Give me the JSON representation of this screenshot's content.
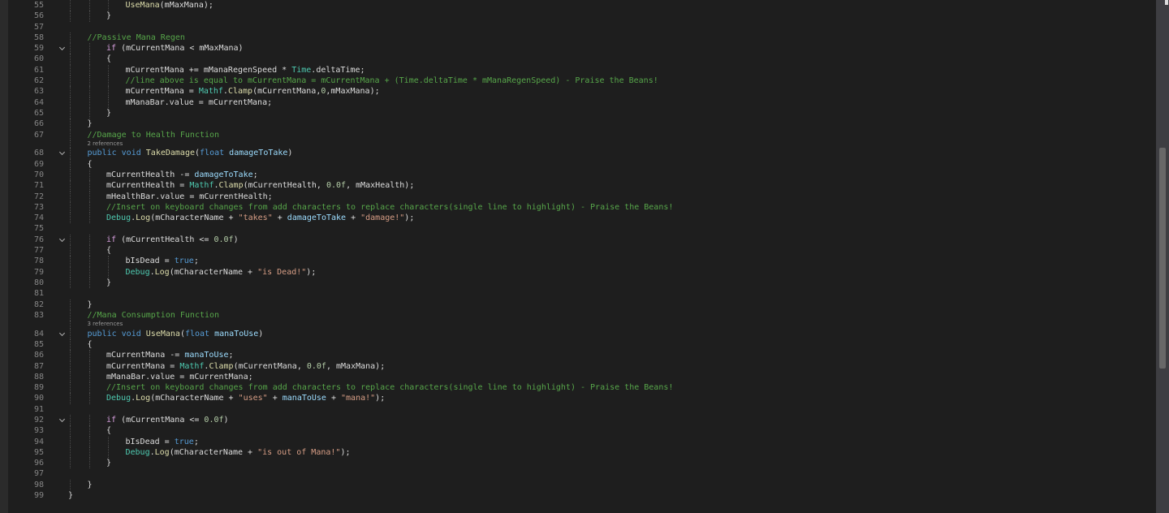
{
  "editor": {
    "file_language": "C#",
    "scrollbar": {
      "vertical": true
    },
    "colors": {
      "background": "#1e1e1e",
      "line_number": "#858585",
      "keyword": "#569cd6",
      "control_keyword": "#d8a0df",
      "type": "#4ec9b0",
      "method": "#dcdcaa",
      "parameter": "#9cdcfe",
      "number": "#b5cea8",
      "string": "#d69d85",
      "comment": "#57a64a",
      "text": "#dcdcdc"
    },
    "rows": [
      {
        "kind": "code",
        "ln": "55",
        "indent": 3,
        "fold": false,
        "tokens": [
          [
            "method",
            "UseMana"
          ],
          [
            "txt",
            "(mMaxMana);"
          ]
        ]
      },
      {
        "kind": "code",
        "ln": "56",
        "indent": 2,
        "fold": false,
        "tokens": [
          [
            "txt",
            "}"
          ]
        ]
      },
      {
        "kind": "code",
        "ln": "57",
        "indent": 0,
        "fold": false,
        "tokens": []
      },
      {
        "kind": "code",
        "ln": "58",
        "indent": 1,
        "fold": false,
        "tokens": [
          [
            "com",
            "//Passive Mana Regen"
          ]
        ]
      },
      {
        "kind": "code",
        "ln": "59",
        "indent": 2,
        "fold": true,
        "tokens": [
          [
            "ctl",
            "if"
          ],
          [
            "txt",
            " (mCurrentMana < mMaxMana)"
          ]
        ]
      },
      {
        "kind": "code",
        "ln": "60",
        "indent": 2,
        "fold": false,
        "tokens": [
          [
            "txt",
            "{"
          ]
        ]
      },
      {
        "kind": "code",
        "ln": "61",
        "indent": 3,
        "fold": false,
        "tokens": [
          [
            "txt",
            "mCurrentMana += mManaRegenSpeed * "
          ],
          [
            "type",
            "Time"
          ],
          [
            "txt",
            ".deltaTime;"
          ]
        ]
      },
      {
        "kind": "code",
        "ln": "62",
        "indent": 3,
        "fold": false,
        "tokens": [
          [
            "com",
            "//line above is equal to mCurrentMana = mCurrentMana + (Time.deltaTime * mManaRegenSpeed) - Praise the Beans!"
          ]
        ]
      },
      {
        "kind": "code",
        "ln": "63",
        "indent": 3,
        "fold": false,
        "tokens": [
          [
            "txt",
            "mCurrentMana = "
          ],
          [
            "type",
            "Mathf"
          ],
          [
            "txt",
            "."
          ],
          [
            "method",
            "Clamp"
          ],
          [
            "txt",
            "(mCurrentMana,"
          ],
          [
            "num",
            "0"
          ],
          [
            "txt",
            ",mMaxMana);"
          ]
        ]
      },
      {
        "kind": "code",
        "ln": "64",
        "indent": 3,
        "fold": false,
        "tokens": [
          [
            "txt",
            "mManaBar.value = mCurrentMana;"
          ]
        ]
      },
      {
        "kind": "code",
        "ln": "65",
        "indent": 2,
        "fold": false,
        "tokens": [
          [
            "txt",
            "}"
          ]
        ]
      },
      {
        "kind": "code",
        "ln": "66",
        "indent": 1,
        "fold": false,
        "tokens": [
          [
            "txt",
            "}"
          ]
        ]
      },
      {
        "kind": "code",
        "ln": "67",
        "indent": 1,
        "fold": false,
        "tokens": [
          [
            "com",
            "//Damage to Health Function"
          ]
        ]
      },
      {
        "kind": "lens",
        "text": "2 references"
      },
      {
        "kind": "code",
        "ln": "68",
        "indent": 1,
        "fold": true,
        "tokens": [
          [
            "kw",
            "public"
          ],
          [
            "txt",
            " "
          ],
          [
            "kw",
            "void"
          ],
          [
            "txt",
            " "
          ],
          [
            "method",
            "TakeDamage"
          ],
          [
            "txt",
            "("
          ],
          [
            "kw",
            "float"
          ],
          [
            "txt",
            " "
          ],
          [
            "param",
            "damageToTake"
          ],
          [
            "txt",
            ")"
          ]
        ]
      },
      {
        "kind": "code",
        "ln": "69",
        "indent": 1,
        "fold": false,
        "tokens": [
          [
            "txt",
            "{"
          ]
        ]
      },
      {
        "kind": "code",
        "ln": "70",
        "indent": 2,
        "fold": false,
        "tokens": [
          [
            "txt",
            "mCurrentHealth -= "
          ],
          [
            "param",
            "damageToTake"
          ],
          [
            "txt",
            ";"
          ]
        ]
      },
      {
        "kind": "code",
        "ln": "71",
        "indent": 2,
        "fold": false,
        "tokens": [
          [
            "txt",
            "mCurrentHealth = "
          ],
          [
            "type",
            "Mathf"
          ],
          [
            "txt",
            "."
          ],
          [
            "method",
            "Clamp"
          ],
          [
            "txt",
            "(mCurrentHealth, "
          ],
          [
            "num",
            "0.0f"
          ],
          [
            "txt",
            ", mMaxHealth);"
          ]
        ]
      },
      {
        "kind": "code",
        "ln": "72",
        "indent": 2,
        "fold": false,
        "tokens": [
          [
            "txt",
            "mHealthBar.value = mCurrentHealth;"
          ]
        ]
      },
      {
        "kind": "code",
        "ln": "73",
        "indent": 2,
        "fold": false,
        "tokens": [
          [
            "com",
            "//Insert on keyboard changes from add characters to replace characters(single line to highlight) - Praise the Beans!"
          ]
        ]
      },
      {
        "kind": "code",
        "ln": "74",
        "indent": 2,
        "fold": false,
        "tokens": [
          [
            "type",
            "Debug"
          ],
          [
            "txt",
            "."
          ],
          [
            "method",
            "Log"
          ],
          [
            "txt",
            "(mCharacterName + "
          ],
          [
            "str",
            "\"takes\""
          ],
          [
            "txt",
            " + "
          ],
          [
            "param",
            "damageToTake"
          ],
          [
            "txt",
            " + "
          ],
          [
            "str",
            "\"damage!\""
          ],
          [
            "txt",
            ");"
          ]
        ]
      },
      {
        "kind": "code",
        "ln": "75",
        "indent": 0,
        "fold": false,
        "tokens": []
      },
      {
        "kind": "code",
        "ln": "76",
        "indent": 2,
        "fold": true,
        "tokens": [
          [
            "ctl",
            "if"
          ],
          [
            "txt",
            " (mCurrentHealth <= "
          ],
          [
            "num",
            "0.0f"
          ],
          [
            "txt",
            ")"
          ]
        ]
      },
      {
        "kind": "code",
        "ln": "77",
        "indent": 2,
        "fold": false,
        "tokens": [
          [
            "txt",
            "{"
          ]
        ]
      },
      {
        "kind": "code",
        "ln": "78",
        "indent": 3,
        "fold": false,
        "tokens": [
          [
            "txt",
            "bIsDead = "
          ],
          [
            "kw",
            "true"
          ],
          [
            "txt",
            ";"
          ]
        ]
      },
      {
        "kind": "code",
        "ln": "79",
        "indent": 3,
        "fold": false,
        "tokens": [
          [
            "type",
            "Debug"
          ],
          [
            "txt",
            "."
          ],
          [
            "method",
            "Log"
          ],
          [
            "txt",
            "(mCharacterName + "
          ],
          [
            "str",
            "\"is Dead!\""
          ],
          [
            "txt",
            ");"
          ]
        ]
      },
      {
        "kind": "code",
        "ln": "80",
        "indent": 2,
        "fold": false,
        "tokens": [
          [
            "txt",
            "}"
          ]
        ]
      },
      {
        "kind": "code",
        "ln": "81",
        "indent": 0,
        "fold": false,
        "tokens": []
      },
      {
        "kind": "code",
        "ln": "82",
        "indent": 1,
        "fold": false,
        "tokens": [
          [
            "txt",
            "}"
          ]
        ]
      },
      {
        "kind": "code",
        "ln": "83",
        "indent": 1,
        "fold": false,
        "tokens": [
          [
            "com",
            "//Mana Consumption Function"
          ]
        ]
      },
      {
        "kind": "lens",
        "text": "3 references"
      },
      {
        "kind": "code",
        "ln": "84",
        "indent": 1,
        "fold": true,
        "tokens": [
          [
            "kw",
            "public"
          ],
          [
            "txt",
            " "
          ],
          [
            "kw",
            "void"
          ],
          [
            "txt",
            " "
          ],
          [
            "method",
            "UseMana"
          ],
          [
            "txt",
            "("
          ],
          [
            "kw",
            "float"
          ],
          [
            "txt",
            " "
          ],
          [
            "param",
            "manaToUse"
          ],
          [
            "txt",
            ")"
          ]
        ]
      },
      {
        "kind": "code",
        "ln": "85",
        "indent": 1,
        "fold": false,
        "tokens": [
          [
            "txt",
            "{"
          ]
        ]
      },
      {
        "kind": "code",
        "ln": "86",
        "indent": 2,
        "fold": false,
        "tokens": [
          [
            "txt",
            "mCurrentMana -= "
          ],
          [
            "param",
            "manaToUse"
          ],
          [
            "txt",
            ";"
          ]
        ]
      },
      {
        "kind": "code",
        "ln": "87",
        "indent": 2,
        "fold": false,
        "tokens": [
          [
            "txt",
            "mCurrentMana = "
          ],
          [
            "type",
            "Mathf"
          ],
          [
            "txt",
            "."
          ],
          [
            "method",
            "Clamp"
          ],
          [
            "txt",
            "(mCurrentMana, "
          ],
          [
            "num",
            "0.0f"
          ],
          [
            "txt",
            ", mMaxMana);"
          ]
        ]
      },
      {
        "kind": "code",
        "ln": "88",
        "indent": 2,
        "fold": false,
        "tokens": [
          [
            "txt",
            "mManaBar.value = mCurrentMana;"
          ]
        ]
      },
      {
        "kind": "code",
        "ln": "89",
        "indent": 2,
        "fold": false,
        "tokens": [
          [
            "com",
            "//Insert on keyboard changes from add characters to replace characters(single line to highlight) - Praise the Beans!"
          ]
        ]
      },
      {
        "kind": "code",
        "ln": "90",
        "indent": 2,
        "fold": false,
        "tokens": [
          [
            "type",
            "Debug"
          ],
          [
            "txt",
            "."
          ],
          [
            "method",
            "Log"
          ],
          [
            "txt",
            "(mCharacterName + "
          ],
          [
            "str",
            "\"uses\""
          ],
          [
            "txt",
            " + "
          ],
          [
            "param",
            "manaToUse"
          ],
          [
            "txt",
            " + "
          ],
          [
            "str",
            "\"mana!\""
          ],
          [
            "txt",
            ");"
          ]
        ]
      },
      {
        "kind": "code",
        "ln": "91",
        "indent": 0,
        "fold": false,
        "tokens": []
      },
      {
        "kind": "code",
        "ln": "92",
        "indent": 2,
        "fold": true,
        "tokens": [
          [
            "ctl",
            "if"
          ],
          [
            "txt",
            " (mCurrentMana <= "
          ],
          [
            "num",
            "0.0f"
          ],
          [
            "txt",
            ")"
          ]
        ]
      },
      {
        "kind": "code",
        "ln": "93",
        "indent": 2,
        "fold": false,
        "tokens": [
          [
            "txt",
            "{"
          ]
        ]
      },
      {
        "kind": "code",
        "ln": "94",
        "indent": 3,
        "fold": false,
        "tokens": [
          [
            "txt",
            "bIsDead = "
          ],
          [
            "kw",
            "true"
          ],
          [
            "txt",
            ";"
          ]
        ]
      },
      {
        "kind": "code",
        "ln": "95",
        "indent": 3,
        "fold": false,
        "tokens": [
          [
            "type",
            "Debug"
          ],
          [
            "txt",
            "."
          ],
          [
            "method",
            "Log"
          ],
          [
            "txt",
            "(mCharacterName + "
          ],
          [
            "str",
            "\"is out of Mana!\""
          ],
          [
            "txt",
            ");"
          ]
        ]
      },
      {
        "kind": "code",
        "ln": "96",
        "indent": 2,
        "fold": false,
        "tokens": [
          [
            "txt",
            "}"
          ]
        ]
      },
      {
        "kind": "code",
        "ln": "97",
        "indent": 0,
        "fold": false,
        "tokens": []
      },
      {
        "kind": "code",
        "ln": "98",
        "indent": 1,
        "fold": false,
        "tokens": [
          [
            "txt",
            "}"
          ]
        ]
      },
      {
        "kind": "code",
        "ln": "99",
        "indent": 0,
        "fold": false,
        "tokens": [
          [
            "txt",
            "}"
          ]
        ]
      }
    ]
  }
}
